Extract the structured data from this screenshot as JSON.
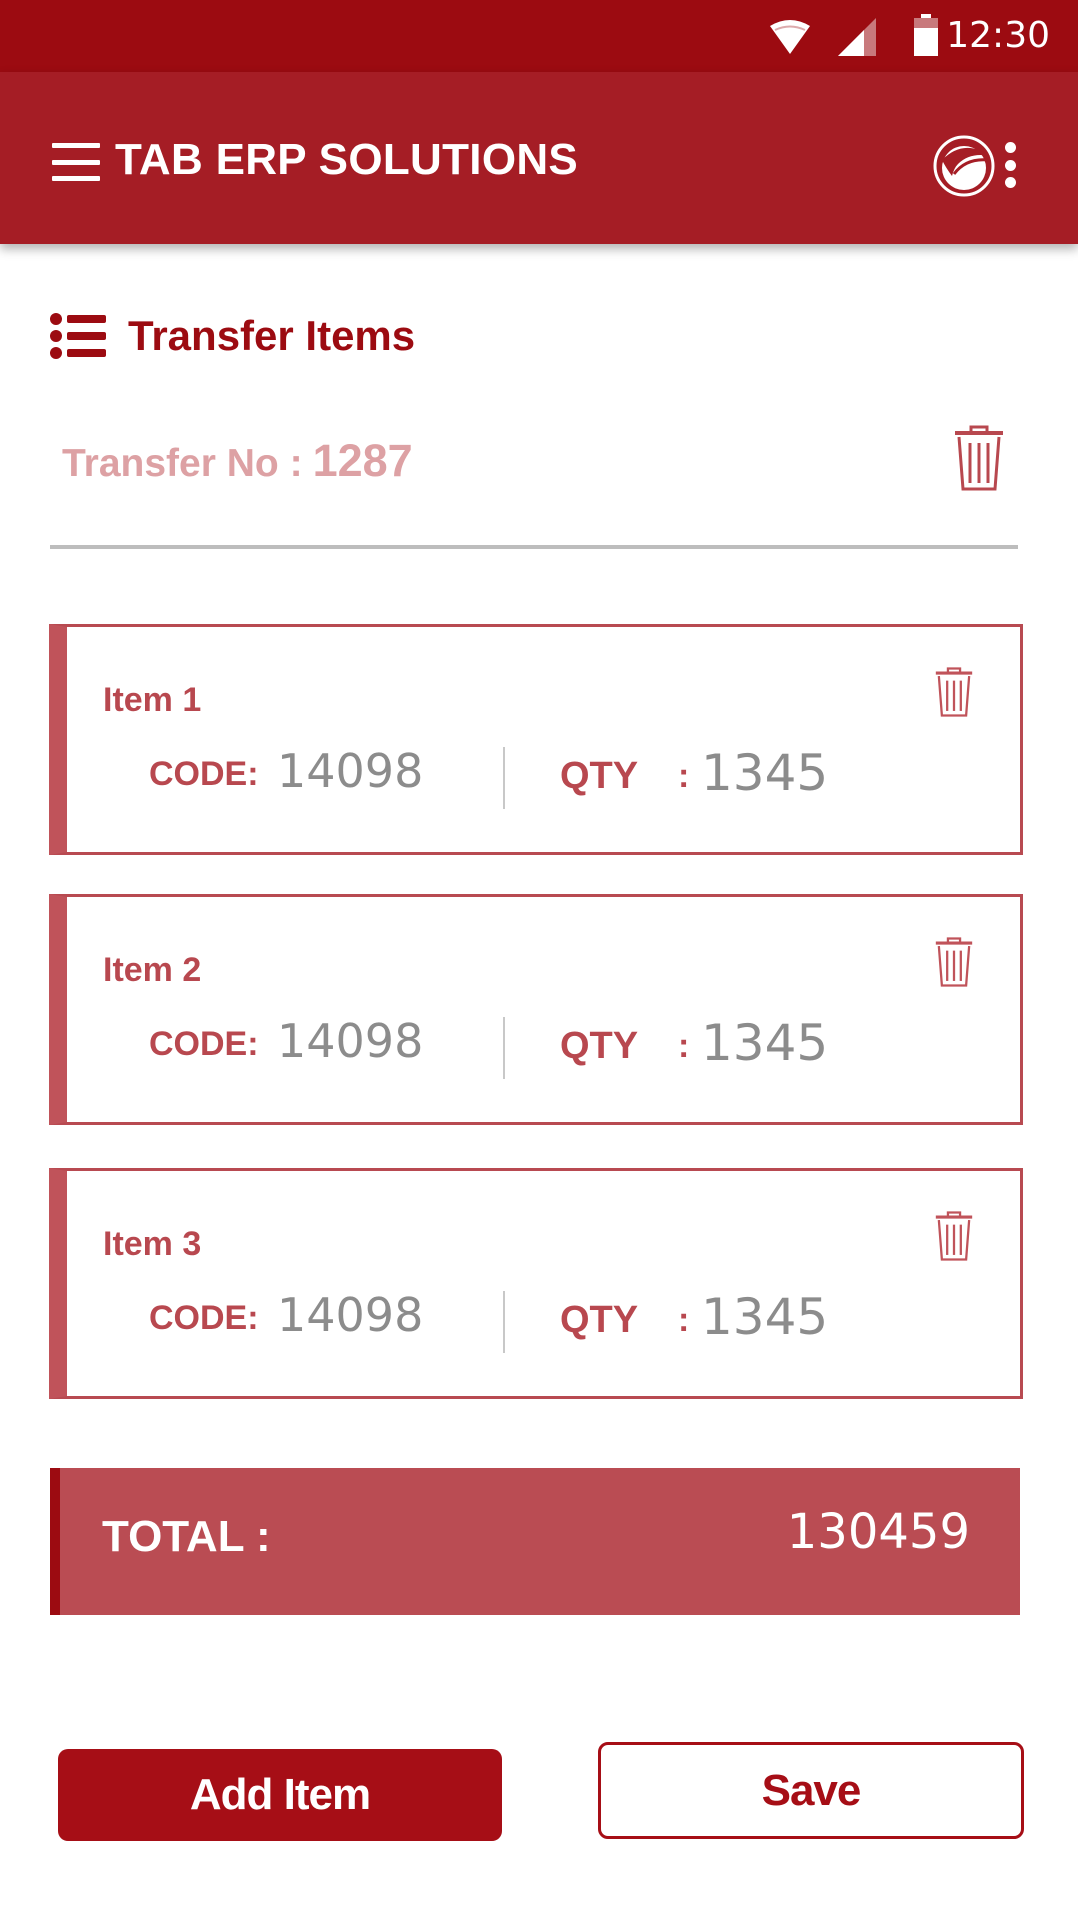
{
  "status_bar": {
    "time": "12:30",
    "icons": [
      "wifi-icon",
      "signal-icon",
      "battery-icon"
    ]
  },
  "app_bar": {
    "title": "TAB ERP SOLUTIONS",
    "icons": [
      "menu-icon",
      "logo-icon",
      "overflow-menu-icon"
    ]
  },
  "section": {
    "title": "Transfer Items",
    "icon": "list-icon"
  },
  "transfer": {
    "label": "Transfer No :",
    "number": "1287",
    "delete_icon": "trash-icon"
  },
  "items": [
    {
      "name": "Item 1",
      "code_label": "CODE:",
      "code": "14098",
      "qty_label": "QTY",
      "qty_sep": ":",
      "qty": "1345"
    },
    {
      "name": "Item 2",
      "code_label": "CODE:",
      "code": "14098",
      "qty_label": "QTY",
      "qty_sep": ":",
      "qty": "1345"
    },
    {
      "name": "Item 3",
      "code_label": "CODE:",
      "code": "14098",
      "qty_label": "QTY",
      "qty_sep": ":",
      "qty": "1345"
    }
  ],
  "total": {
    "label": "TOTAL :",
    "value": "130459"
  },
  "actions": {
    "add_label": "Add Item",
    "save_label": "Save"
  },
  "colors": {
    "status_bar": "#9c0b11",
    "app_bar": "#a51d25",
    "accent": "#9c0b11",
    "card_accent": "#b8484f",
    "total_bar": "#ba4c53",
    "button_primary": "#a60e16"
  }
}
